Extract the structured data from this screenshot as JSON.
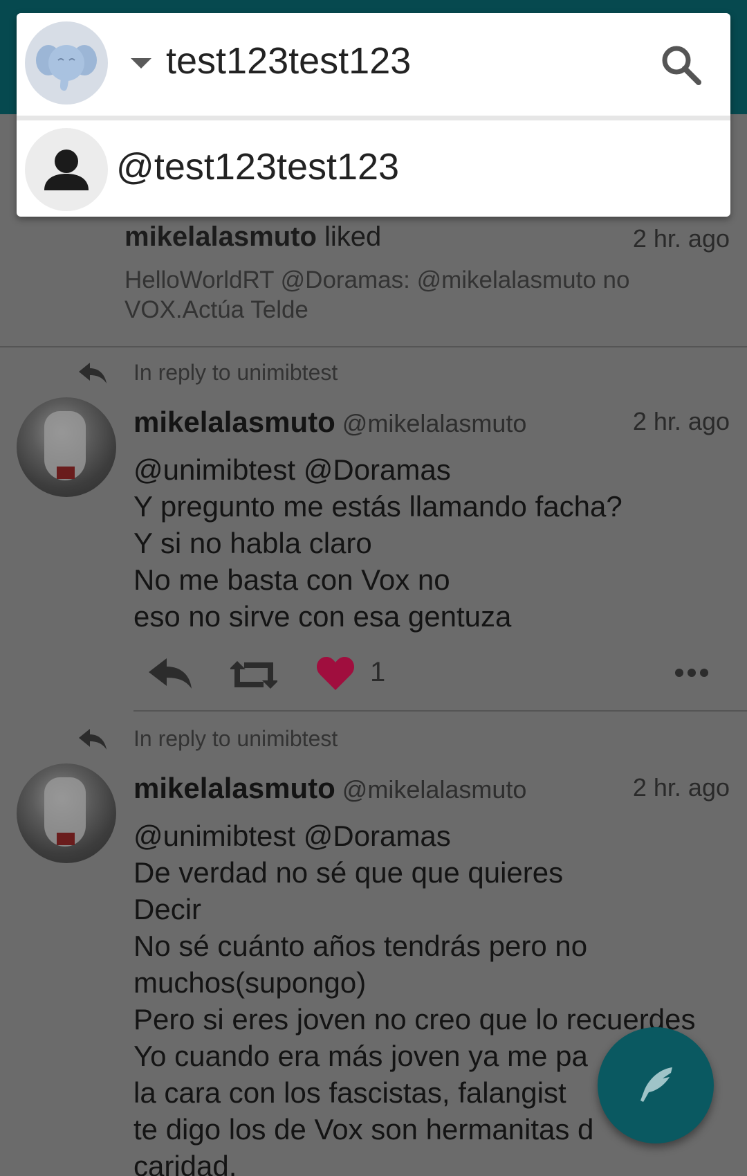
{
  "account": {
    "name": "test123test123",
    "handle": "@test123test123"
  },
  "liked_notification": {
    "user": "mikelalasmuto",
    "action": " liked",
    "time": "2 hr. ago",
    "excerpt": "HelloWorldRT @Doramas: @mikelalasmuto no VOX.Actúa Telde"
  },
  "statuses": [
    {
      "reply_to": "In reply to unimibtest",
      "name": "mikelalasmuto",
      "handle": "@mikelalasmuto",
      "time": "2 hr. ago",
      "content": "@unimibtest @Doramas\nY pregunto me estás llamando facha?\nY si no habla claro\nNo me basta con Vox no\neso no sirve con esa gentuza",
      "like_count": "1"
    },
    {
      "reply_to": "In reply to unimibtest",
      "name": "mikelalasmuto",
      "handle": "@mikelalasmuto",
      "time": "2 hr. ago",
      "content": "@unimibtest @Doramas\nDe verdad no sé que que quieres\nDecir\nNo sé cuánto años tendrás pero no\nmuchos(supongo)\nPero si eres joven no creo que lo recuerdes\nYo cuando era más joven ya me pa\nla cara con los fascistas, falangist\nte digo los de Vox son hermanitas d\ncaridad."
    }
  ],
  "icons": {
    "account_avatar": "mastodon-elephant-icon",
    "dropdown": "caret-down-icon",
    "search": "search-icon",
    "person": "person-icon",
    "reply": "reply-icon",
    "boost": "boost-icon",
    "favourite": "heart-icon",
    "more": "more-horizontal-icon",
    "compose": "quill-icon"
  },
  "colors": {
    "toolbar": "#06494f",
    "favourite": "#a00e3e",
    "fab": "#0a5961"
  }
}
